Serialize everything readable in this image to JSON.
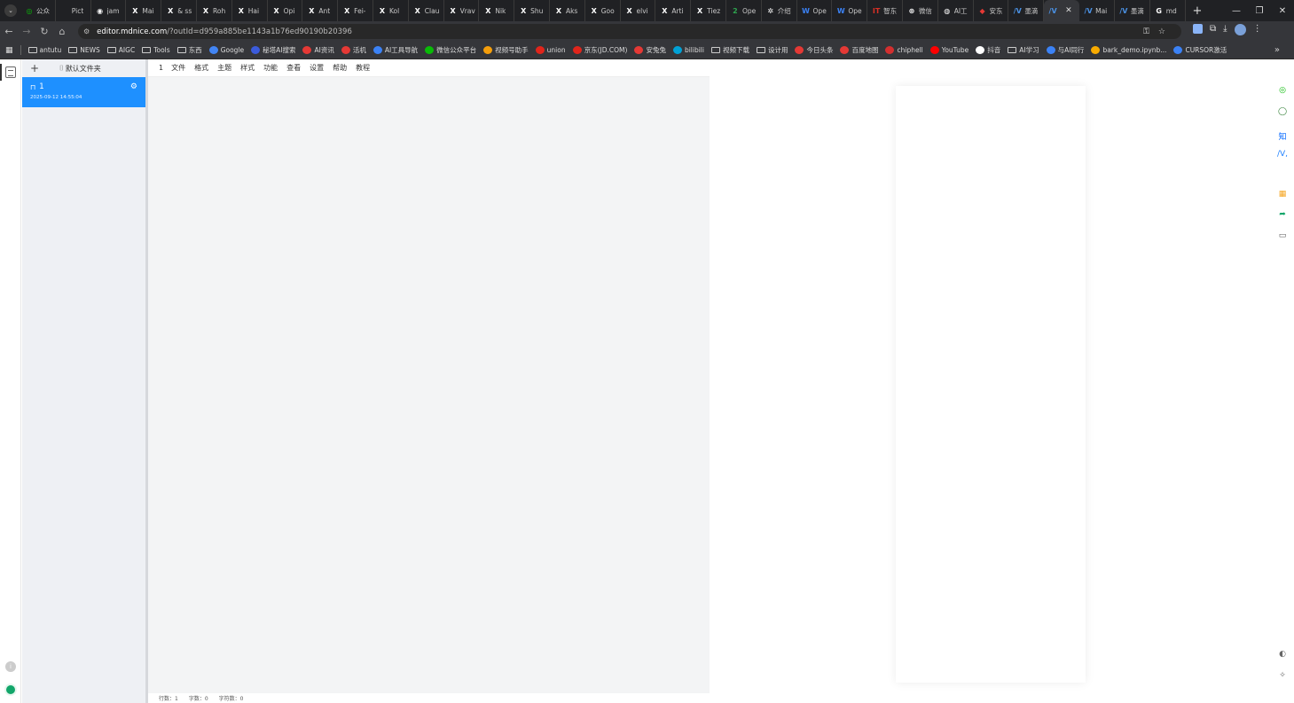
{
  "browser": {
    "tabs": [
      {
        "icon": "wechat-icon",
        "glyph": "◎",
        "color": "#09bb07",
        "label": "公众"
      },
      {
        "icon": "blank-icon",
        "glyph": "",
        "color": "#202124",
        "label": "Pict"
      },
      {
        "icon": "github-icon",
        "glyph": "◉",
        "color": "#ffffff",
        "label": "jam"
      },
      {
        "icon": "x-icon",
        "glyph": "X",
        "color": "#ffffff",
        "label": "Mai"
      },
      {
        "icon": "x-icon",
        "glyph": "X",
        "color": "#ffffff",
        "label": "& ss"
      },
      {
        "icon": "x-icon",
        "glyph": "X",
        "color": "#ffffff",
        "label": "Roh"
      },
      {
        "icon": "x-icon",
        "glyph": "X",
        "color": "#ffffff",
        "label": "Hai"
      },
      {
        "icon": "x-icon",
        "glyph": "X",
        "color": "#ffffff",
        "label": "Opi"
      },
      {
        "icon": "x-icon",
        "glyph": "X",
        "color": "#ffffff",
        "label": "Ant"
      },
      {
        "icon": "x-icon",
        "glyph": "X",
        "color": "#ffffff",
        "label": "Fei-"
      },
      {
        "icon": "x-icon",
        "glyph": "X",
        "color": "#ffffff",
        "label": "Kol"
      },
      {
        "icon": "x-icon",
        "glyph": "X",
        "color": "#ffffff",
        "label": "Clau"
      },
      {
        "icon": "x-icon",
        "glyph": "X",
        "color": "#ffffff",
        "label": "Vrav"
      },
      {
        "icon": "x-icon",
        "glyph": "X",
        "color": "#ffffff",
        "label": "Nik"
      },
      {
        "icon": "x-icon",
        "glyph": "X",
        "color": "#ffffff",
        "label": "Shu"
      },
      {
        "icon": "x-icon",
        "glyph": "X",
        "color": "#ffffff",
        "label": "Aks"
      },
      {
        "icon": "x-icon",
        "glyph": "X",
        "color": "#ffffff",
        "label": "Goo"
      },
      {
        "icon": "x-icon",
        "glyph": "X",
        "color": "#ffffff",
        "label": "elvi"
      },
      {
        "icon": "x-icon",
        "glyph": "X",
        "color": "#ffffff",
        "label": "Arti"
      },
      {
        "icon": "x-icon",
        "glyph": "X",
        "color": "#ffffff",
        "label": "Tiez"
      },
      {
        "icon": "open-icon",
        "glyph": "2",
        "color": "#2ea44f",
        "label": "Ope"
      },
      {
        "icon": "intro-icon",
        "glyph": "✲",
        "color": "#ffffff",
        "label": "介绍"
      },
      {
        "icon": "w-icon",
        "glyph": "W",
        "color": "#3b82f6",
        "label": "Ope"
      },
      {
        "icon": "w-icon",
        "glyph": "W",
        "color": "#3b82f6",
        "label": "Ope"
      },
      {
        "icon": "it-icon",
        "glyph": "IT",
        "color": "#d93025",
        "label": "智东"
      },
      {
        "icon": "wechat-circle-icon",
        "glyph": "⊛",
        "color": "#ffffff",
        "label": "微信"
      },
      {
        "icon": "ai-icon",
        "glyph": "◍",
        "color": "#ffffff",
        "label": "AI工"
      },
      {
        "icon": "ant-icon",
        "glyph": "◆",
        "color": "#e53935",
        "label": "安东"
      },
      {
        "icon": "mdnice-icon",
        "glyph": "/V",
        "color": "#4a90e2",
        "label": "墨滴"
      },
      {
        "icon": "mdnice-icon",
        "glyph": "/V",
        "color": "#4a90e2",
        "label": "",
        "active": true
      },
      {
        "icon": "mdnice-icon",
        "glyph": "/V",
        "color": "#4a90e2",
        "label": "Mai"
      },
      {
        "icon": "mdnice-icon",
        "glyph": "/V",
        "color": "#4a90e2",
        "label": "墨滴"
      },
      {
        "icon": "google-icon",
        "glyph": "G",
        "color": "#ffffff",
        "label": "md"
      }
    ],
    "new_tab": "+",
    "url_host": "editor.mdnice.com",
    "url_path": "/?outId=d959a885be1143a1b76ed90190b20396",
    "bookmarks": [
      {
        "icon": "folder-icon",
        "label": "antutu",
        "folder": true
      },
      {
        "icon": "folder-icon",
        "label": "NEWS",
        "folder": true
      },
      {
        "icon": "folder-icon",
        "label": "AIGC",
        "folder": true
      },
      {
        "icon": "folder-icon",
        "label": "Tools",
        "folder": true
      },
      {
        "icon": "folder-icon",
        "label": "东西",
        "folder": true
      },
      {
        "icon": "google-icon",
        "label": "Google",
        "color": "#4285f4"
      },
      {
        "icon": "search-icon",
        "label": "秘塔AI搜索",
        "color": "#3b5bdb"
      },
      {
        "icon": "ai-news-icon",
        "label": "AI资讯",
        "color": "#e53935"
      },
      {
        "icon": "live-icon",
        "label": "活机",
        "color": "#e53935"
      },
      {
        "icon": "ai-tools-icon",
        "label": "AI工具导航",
        "color": "#3b82f6"
      },
      {
        "icon": "wechat-icon",
        "label": "微信公众平台",
        "color": "#09bb07"
      },
      {
        "icon": "video-icon",
        "label": "视频号助手",
        "color": "#f59e0b"
      },
      {
        "icon": "jd-icon",
        "label": "union",
        "color": "#e1251b"
      },
      {
        "icon": "jd-icon",
        "label": "京东(JD.COM)",
        "color": "#e1251b"
      },
      {
        "icon": "ant-icon",
        "label": "安兔兔",
        "color": "#e53935"
      },
      {
        "icon": "bilibili-icon",
        "label": "bilibili",
        "color": "#00a1d6"
      },
      {
        "icon": "folder-icon",
        "label": "视频下载",
        "folder": true
      },
      {
        "icon": "folder-icon",
        "label": "设计用",
        "folder": true
      },
      {
        "icon": "toutiao-icon",
        "label": "今日头条",
        "color": "#e53935"
      },
      {
        "icon": "baidu-map-icon",
        "label": "百度地图",
        "color": "#e53935"
      },
      {
        "icon": "chiphell-icon",
        "label": "chiphell",
        "color": "#d32f2f"
      },
      {
        "icon": "youtube-icon",
        "label": "YouTube",
        "color": "#ff0000"
      },
      {
        "icon": "douyin-icon",
        "label": "抖音",
        "color": "#ffffff"
      },
      {
        "icon": "folder-icon",
        "label": "AI学习",
        "folder": true
      },
      {
        "icon": "ai-peer-icon",
        "label": "与AI同行",
        "color": "#3b82f6"
      },
      {
        "icon": "colab-icon",
        "label": "bark_demo.ipynb...",
        "color": "#f9ab00"
      },
      {
        "icon": "cursor-icon",
        "label": "CURSOR激活",
        "color": "#3b82f6"
      }
    ],
    "bookmarks_more": "»"
  },
  "sidebar": {
    "add": "+",
    "folder_label": "默认文件夹",
    "doc_title": "1",
    "doc_date": "2025-09-12 14:55:04"
  },
  "menu": {
    "line_no": "1",
    "items": [
      "文件",
      "格式",
      "主题",
      "样式",
      "功能",
      "查看",
      "设置",
      "帮助",
      "教程"
    ]
  },
  "status": {
    "lines": "行数：1",
    "words": "字数：0",
    "chars": "字符数：0"
  },
  "right_tools": [
    {
      "icon": "wechat-icon",
      "glyph": "◎",
      "color": "#09bb07"
    },
    {
      "icon": "theme-icon",
      "glyph": "◯",
      "color": "#2e7d32"
    },
    {
      "icon": "zhihu-icon",
      "glyph": "知",
      "color": "#0066ff"
    },
    {
      "icon": "juejin-icon",
      "glyph": "/V,",
      "color": "#1e80ff"
    },
    {
      "icon": "grid-icon",
      "glyph": "▦",
      "color": "#f5a623"
    },
    {
      "icon": "share-icon",
      "glyph": "➦",
      "color": "#12a66a"
    },
    {
      "icon": "monitor-icon",
      "glyph": "▭",
      "color": "#555555"
    },
    {
      "icon": "palette-icon",
      "glyph": "◐",
      "color": "#666666"
    },
    {
      "icon": "magic-icon",
      "glyph": "✧",
      "color": "#666666"
    }
  ]
}
